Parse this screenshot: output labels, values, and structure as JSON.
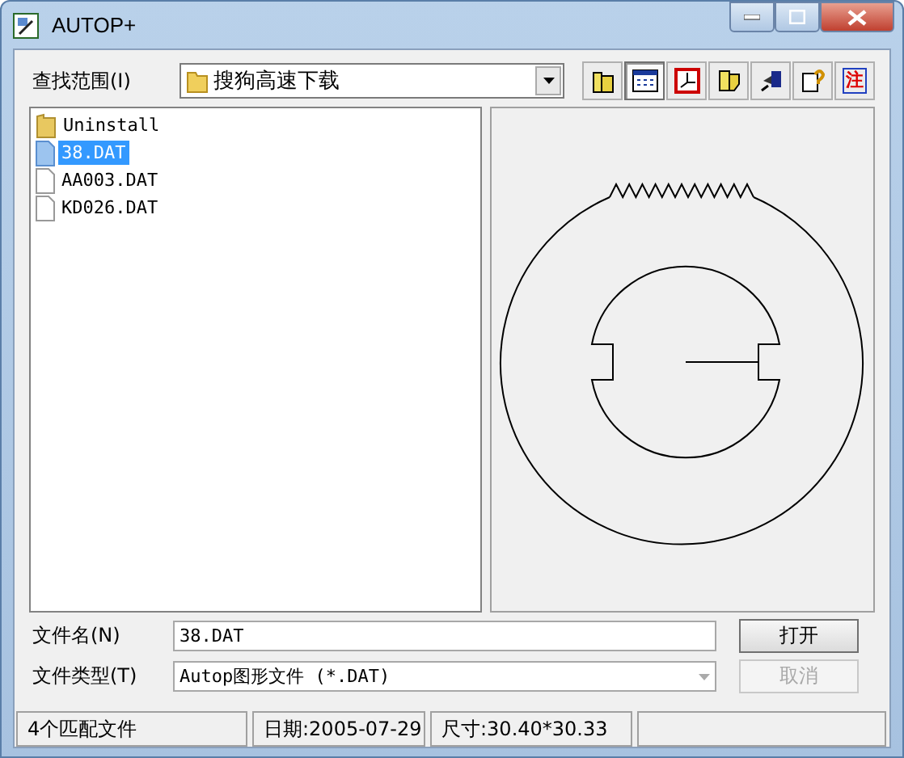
{
  "window": {
    "title": "AUTOP+"
  },
  "look_in": {
    "label": "查找范围(I)",
    "value": "搜狗高速下载"
  },
  "toolbar": [
    {
      "kind": "folder",
      "selected": false
    },
    {
      "kind": "grid",
      "selected": true
    },
    {
      "kind": "frame",
      "selected": false
    },
    {
      "kind": "open",
      "selected": false
    },
    {
      "kind": "device",
      "selected": false
    },
    {
      "kind": "help",
      "selected": false
    },
    {
      "kind": "note",
      "label": "注",
      "selected": false
    }
  ],
  "files": [
    {
      "name": "Uninstall",
      "kind": "folder",
      "selected": false
    },
    {
      "name": "38.DAT",
      "kind": "file",
      "selected": true
    },
    {
      "name": "AA003.DAT",
      "kind": "file",
      "selected": false
    },
    {
      "name": "KD026.DAT",
      "kind": "file",
      "selected": false
    }
  ],
  "file_name": {
    "label": "文件名(N)",
    "value": "38.DAT"
  },
  "file_type": {
    "label": "文件类型(T)",
    "value": "Autop图形文件 (*.DAT)"
  },
  "buttons": [
    {
      "label": "打开",
      "disabled": false
    },
    {
      "label": "取消",
      "disabled": true
    }
  ],
  "status_bar": [
    "4个匹配文件",
    "日期:2005-07-29",
    "尺寸:30.40*30.33"
  ]
}
